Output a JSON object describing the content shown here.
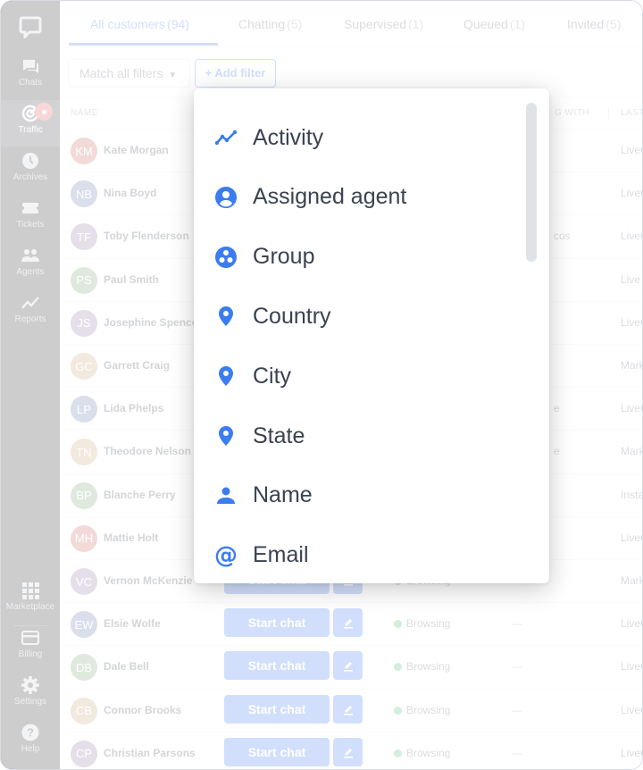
{
  "sidebar": {
    "items": [
      {
        "label": "Chats",
        "icon": "chats-icon"
      },
      {
        "label": "Traffic",
        "icon": "traffic-icon",
        "active": true,
        "badge": true
      },
      {
        "label": "Archives",
        "icon": "clock-icon"
      },
      {
        "label": "Tickets",
        "icon": "ticket-icon"
      },
      {
        "label": "Agents",
        "icon": "agents-icon"
      },
      {
        "label": "Reports",
        "icon": "reports-icon"
      },
      {
        "label": "Marketplace",
        "icon": "grid-icon"
      },
      {
        "label": "Billing",
        "icon": "card-icon"
      },
      {
        "label": "Settings",
        "icon": "gear-icon"
      },
      {
        "label": "Help",
        "icon": "help-icon"
      }
    ]
  },
  "tabs": [
    {
      "label": "All customers",
      "count": "(94)",
      "active": true
    },
    {
      "label": "Chatting",
      "count": "(5)"
    },
    {
      "label": "Supervised",
      "count": "(1)"
    },
    {
      "label": "Queued",
      "count": "(1)"
    },
    {
      "label": "Invited",
      "count": "(5)"
    }
  ],
  "filters": {
    "match_label": "Match all filters",
    "add_filter_label": "+ Add filter"
  },
  "table": {
    "headers": {
      "name": "NAME",
      "chatting_with": "G WITH",
      "last_page": "LAST"
    },
    "start_chat_label": "Start chat",
    "rows": [
      {
        "initials": "KM",
        "name": "Kate Morgan",
        "color": "#c4584f",
        "status": "",
        "chatting": "",
        "partial": "",
        "last": "LiveC"
      },
      {
        "initials": "NB",
        "name": "Nina Boyd",
        "color": "#5a6aa6",
        "status": "",
        "chatting": "",
        "partial": "",
        "last": "LiveC"
      },
      {
        "initials": "TF",
        "name": "Toby Flenderson",
        "color": "#8b6f9c",
        "status": "",
        "chatting": "",
        "partial": "cos",
        "last": "LiveC"
      },
      {
        "initials": "PS",
        "name": "Paul Smith",
        "color": "#6f9d6a",
        "status": "",
        "chatting": "",
        "partial": "",
        "last": "Live"
      },
      {
        "initials": "JS",
        "name": "Josephine Spence",
        "color": "#8b6f9c",
        "status": "",
        "chatting": "",
        "partial": "",
        "last": "LiveC"
      },
      {
        "initials": "GC",
        "name": "Garrett Craig",
        "color": "#c49a6c",
        "status": "",
        "chatting": "",
        "partial": "",
        "last": "Mark"
      },
      {
        "initials": "LP",
        "name": "Lida Phelps",
        "color": "#5a6aa6",
        "status": "",
        "chatting": "",
        "partial": "e",
        "last": "LiveC"
      },
      {
        "initials": "TN",
        "name": "Theodore Nelson",
        "color": "#c49a6c",
        "status": "",
        "chatting": "",
        "partial": "e",
        "last": "Mark"
      },
      {
        "initials": "BP",
        "name": "Blanche Perry",
        "color": "#6f9d6a",
        "status": "",
        "chatting": "",
        "partial": "",
        "last": "Insta"
      },
      {
        "initials": "MH",
        "name": "Mattie Holt",
        "color": "#c4584f",
        "status": "",
        "chatting": "",
        "partial": "",
        "last": "LiveC"
      },
      {
        "initials": "VC",
        "name": "Vernon McKenzie",
        "color": "#8b6f9c",
        "status": "Browsing",
        "chatting": "",
        "partial": "",
        "last": "Mark"
      },
      {
        "initials": "EW",
        "name": "Elsie Wolfe",
        "color": "#5a6aa6",
        "status": "Browsing",
        "chatting": "—",
        "partial": "",
        "last": "LiveC"
      },
      {
        "initials": "DB",
        "name": "Dale Bell",
        "color": "#6f9d6a",
        "status": "Browsing",
        "chatting": "—",
        "partial": "",
        "last": "LiveC"
      },
      {
        "initials": "CB",
        "name": "Connor Brooks",
        "color": "#c49a6c",
        "status": "Browsing",
        "chatting": "—",
        "partial": "",
        "last": "LiveC"
      },
      {
        "initials": "CP",
        "name": "Christian Parsons",
        "color": "#8b6f9c",
        "status": "Browsing",
        "chatting": "—",
        "partial": "",
        "last": "LiveC"
      }
    ]
  },
  "dropdown": {
    "items": [
      {
        "label": "Activity",
        "icon": "activity-icon"
      },
      {
        "label": "Assigned agent",
        "icon": "assigned-agent-icon"
      },
      {
        "label": "Group",
        "icon": "group-icon"
      },
      {
        "label": "Country",
        "icon": "location-pin-icon"
      },
      {
        "label": "City",
        "icon": "location-pin-icon"
      },
      {
        "label": "State",
        "icon": "location-pin-icon"
      },
      {
        "label": "Name",
        "icon": "person-icon"
      },
      {
        "label": "Email",
        "icon": "at-icon"
      }
    ]
  },
  "colors": {
    "accent": "#2d6ff0",
    "icon_blue": "#3b7cf0",
    "sidebar_bg": "#1b1b20",
    "browsing_dot": "#2fb36b",
    "badge": "#e5484d"
  }
}
